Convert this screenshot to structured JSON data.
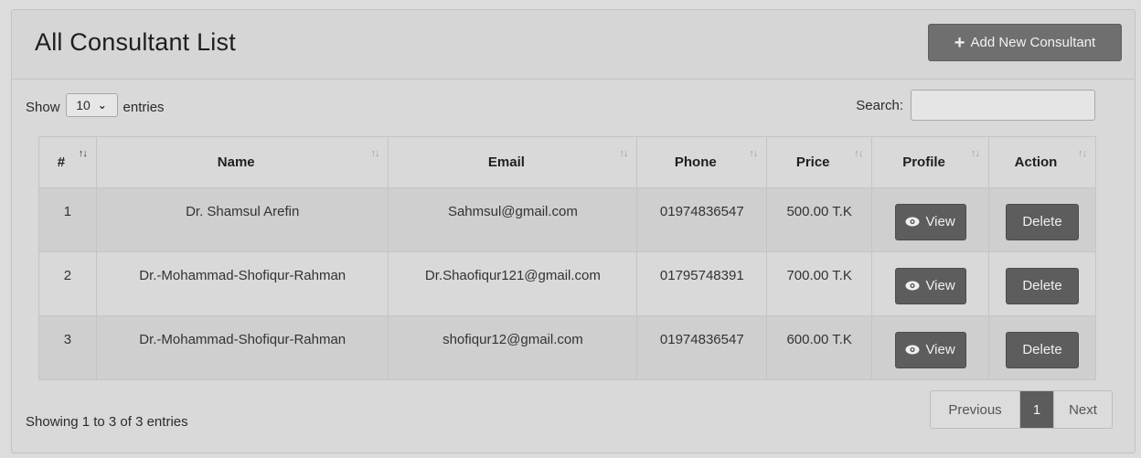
{
  "header": {
    "title": "All Consultant List",
    "add_button": "Add New Consultant"
  },
  "controls": {
    "show_label": "Show",
    "entries_value": "10",
    "entries_label": "entries",
    "search_label": "Search:"
  },
  "columns": [
    "#",
    "Name",
    "Email",
    "Phone",
    "Price",
    "Profile",
    "Action"
  ],
  "rows": [
    {
      "num": "1",
      "name": "Dr. Shamsul Arefin",
      "email": "Sahmsul@gmail.com",
      "phone": "01974836547",
      "price": "500.00 T.K"
    },
    {
      "num": "2",
      "name": "Dr.-Mohammad-Shofiqur-Rahman",
      "email": "Dr.Shaofiqur121@gmail.com",
      "phone": "01795748391",
      "price": "700.00 T.K"
    },
    {
      "num": "3",
      "name": "Dr.-Mohammad-Shofiqur-Rahman",
      "email": "shofiqur12@gmail.com",
      "phone": "01974836547",
      "price": "600.00 T.K"
    }
  ],
  "row_actions": {
    "view": "View",
    "delete": "Delete"
  },
  "footer": {
    "info": "Showing 1 to 3 of 3 entries",
    "prev": "Previous",
    "page": "1",
    "next": "Next"
  }
}
